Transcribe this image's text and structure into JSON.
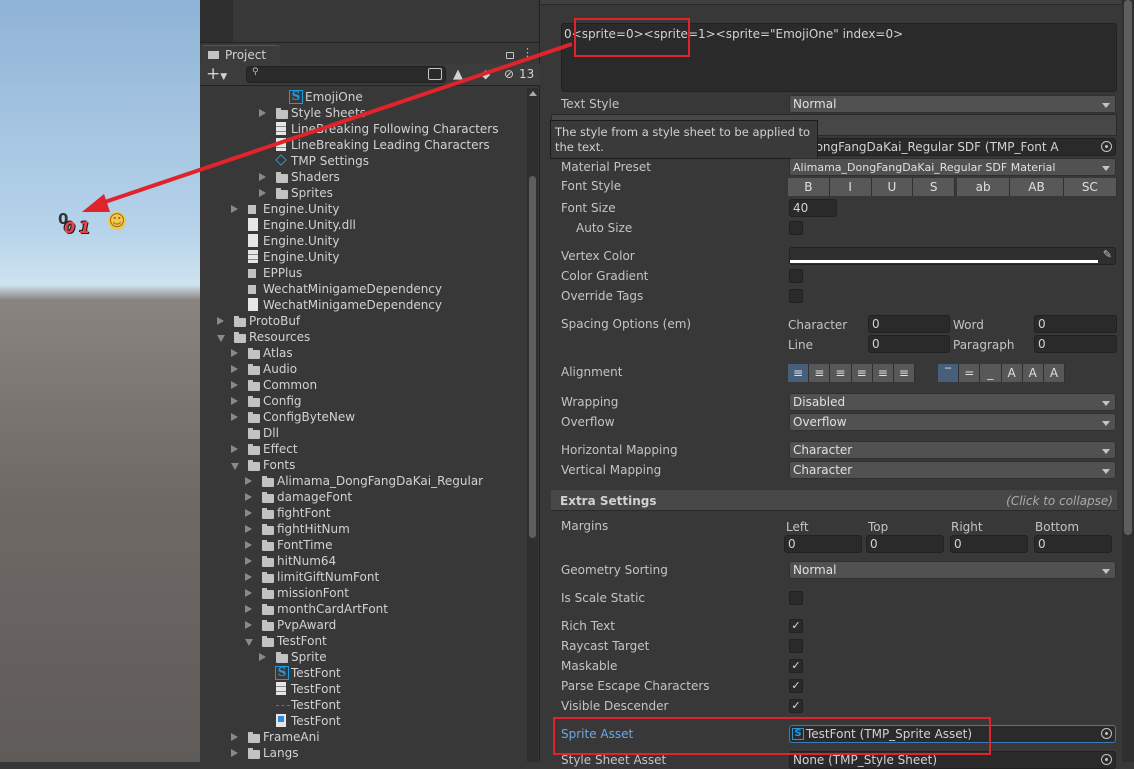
{
  "scene": {
    "rendered_text": "0",
    "sprite_digits": "01",
    "emoji": "☺"
  },
  "project": {
    "tab_label": "Project",
    "hidden_count": "13",
    "search_placeholder": "",
    "tree": [
      {
        "label": "EmojiOne",
        "level": 4,
        "icon": "sprite-asset-icon"
      },
      {
        "label": "Style Sheets",
        "level": 3,
        "icon": "folder-icon",
        "arrow": "closed"
      },
      {
        "label": "LineBreaking Following Characters",
        "level": 3,
        "icon": "text-file-icon"
      },
      {
        "label": "LineBreaking Leading Characters",
        "level": 3,
        "icon": "text-file-icon"
      },
      {
        "label": "TMP Settings",
        "level": 3,
        "icon": "settings-asset-icon"
      },
      {
        "label": "Shaders",
        "level": 3,
        "icon": "folder-icon",
        "arrow": "closed"
      },
      {
        "label": "Sprites",
        "level": 3,
        "icon": "folder-icon",
        "arrow": "closed"
      },
      {
        "label": "Engine.Unity",
        "level": 1,
        "icon": "assembly-icon",
        "arrow": "closed"
      },
      {
        "label": "Engine.Unity.dll",
        "level": 1,
        "icon": "file-icon"
      },
      {
        "label": "Engine.Unity",
        "level": 1,
        "icon": "file-icon"
      },
      {
        "label": "Engine.Unity",
        "level": 1,
        "icon": "text-file-icon"
      },
      {
        "label": "EPPlus",
        "level": 1,
        "icon": "assembly-icon"
      },
      {
        "label": "WechatMinigameDependency",
        "level": 1,
        "icon": "assembly-icon"
      },
      {
        "label": "WechatMinigameDependency",
        "level": 1,
        "icon": "file-icon"
      },
      {
        "label": "ProtoBuf",
        "level": 0,
        "icon": "folder-icon",
        "arrow": "closed"
      },
      {
        "label": "Resources",
        "level": 0,
        "icon": "folder-open-icon",
        "arrow": "open"
      },
      {
        "label": "Atlas",
        "level": 1,
        "icon": "folder-icon",
        "arrow": "closed"
      },
      {
        "label": "Audio",
        "level": 1,
        "icon": "folder-icon",
        "arrow": "closed"
      },
      {
        "label": "Common",
        "level": 1,
        "icon": "folder-icon",
        "arrow": "closed"
      },
      {
        "label": "Config",
        "level": 1,
        "icon": "folder-icon",
        "arrow": "closed"
      },
      {
        "label": "ConfigByteNew",
        "level": 1,
        "icon": "folder-icon",
        "arrow": "closed"
      },
      {
        "label": "Dll",
        "level": 1,
        "icon": "folder-icon"
      },
      {
        "label": "Effect",
        "level": 1,
        "icon": "folder-icon",
        "arrow": "closed"
      },
      {
        "label": "Fonts",
        "level": 1,
        "icon": "folder-open-icon",
        "arrow": "open"
      },
      {
        "label": "Alimama_DongFangDaKai_Regular",
        "level": 2,
        "icon": "folder-icon",
        "arrow": "closed"
      },
      {
        "label": "damageFont",
        "level": 2,
        "icon": "folder-icon",
        "arrow": "closed"
      },
      {
        "label": "fightFont",
        "level": 2,
        "icon": "folder-icon",
        "arrow": "closed"
      },
      {
        "label": "fightHitNum",
        "level": 2,
        "icon": "folder-icon",
        "arrow": "closed"
      },
      {
        "label": "FontTime",
        "level": 2,
        "icon": "folder-icon",
        "arrow": "closed"
      },
      {
        "label": "hitNum64",
        "level": 2,
        "icon": "folder-icon",
        "arrow": "closed"
      },
      {
        "label": "limitGiftNumFont",
        "level": 2,
        "icon": "folder-icon",
        "arrow": "closed"
      },
      {
        "label": "missionFont",
        "level": 2,
        "icon": "folder-icon",
        "arrow": "closed"
      },
      {
        "label": "monthCardArtFont",
        "level": 2,
        "icon": "folder-icon",
        "arrow": "closed"
      },
      {
        "label": "PvpAward",
        "level": 2,
        "icon": "folder-icon",
        "arrow": "closed"
      },
      {
        "label": "TestFont",
        "level": 2,
        "icon": "folder-open-icon",
        "arrow": "open"
      },
      {
        "label": "Sprite",
        "level": 3,
        "icon": "folder-icon",
        "arrow": "closed"
      },
      {
        "label": "TestFont",
        "level": 3,
        "icon": "sprite-asset-icon"
      },
      {
        "label": "TestFont",
        "level": 3,
        "icon": "text-file-icon"
      },
      {
        "label": "TestFont",
        "level": 3,
        "icon": "line-asset-icon"
      },
      {
        "label": "TestFont",
        "level": 3,
        "icon": "prefab-file-icon"
      },
      {
        "label": "FrameAni",
        "level": 1,
        "icon": "folder-icon",
        "arrow": "closed"
      },
      {
        "label": "Langs",
        "level": 1,
        "icon": "folder-icon",
        "arrow": "closed"
      }
    ]
  },
  "inspector": {
    "text_input": "0<sprite=0><sprite=1><sprite=\"EmojiOne\" index=0>",
    "text_style": {
      "label": "Text Style",
      "value": "Normal"
    },
    "tooltip": "The style from a style sheet to be applied to the text.",
    "font_asset": {
      "value": "a_DongFangDaKai_Regular SDF (TMP_Font A"
    },
    "material_preset": {
      "label": "Material Preset",
      "value": "Alimama_DongFangDaKai_Regular SDF Material"
    },
    "font_style": {
      "label": "Font Style",
      "buttons": [
        "B",
        "I",
        "U",
        "S",
        "ab",
        "AB",
        "SC"
      ]
    },
    "font_size": {
      "label": "Font Size",
      "value": "40"
    },
    "auto_size": {
      "label": "Auto Size",
      "checked": false
    },
    "vertex_color": {
      "label": "Vertex Color",
      "color": "#ffffff"
    },
    "color_gradient": {
      "label": "Color Gradient",
      "checked": false
    },
    "override_tags": {
      "label": "Override Tags",
      "checked": false
    },
    "spacing": {
      "label": "Spacing Options (em)",
      "character_label": "Character",
      "character": "0",
      "word_label": "Word",
      "word": "0",
      "line_label": "Line",
      "line": "0",
      "paragraph_label": "Paragraph",
      "paragraph": "0"
    },
    "alignment": {
      "label": "Alignment",
      "horizontal_selected": "left",
      "vertical_selected": "top"
    },
    "wrapping": {
      "label": "Wrapping",
      "value": "Disabled"
    },
    "overflow": {
      "label": "Overflow",
      "value": "Overflow"
    },
    "horizontal_mapping": {
      "label": "Horizontal Mapping",
      "value": "Character"
    },
    "vertical_mapping": {
      "label": "Vertical Mapping",
      "value": "Character"
    },
    "extra_settings": {
      "title": "Extra Settings",
      "hint": "(Click to collapse)"
    },
    "margins": {
      "label": "Margins",
      "left_label": "Left",
      "left": "0",
      "top_label": "Top",
      "top": "0",
      "right_label": "Right",
      "right": "0",
      "bottom_label": "Bottom",
      "bottom": "0"
    },
    "geometry_sorting": {
      "label": "Geometry Sorting",
      "value": "Normal"
    },
    "is_scale_static": {
      "label": "Is Scale Static",
      "checked": false
    },
    "rich_text": {
      "label": "Rich Text",
      "checked": true
    },
    "raycast_target": {
      "label": "Raycast Target",
      "checked": false
    },
    "maskable": {
      "label": "Maskable",
      "checked": true
    },
    "parse_escape": {
      "label": "Parse Escape Characters",
      "checked": true
    },
    "visible_descender": {
      "label": "Visible Descender",
      "checked": true
    },
    "sprite_asset": {
      "label": "Sprite Asset",
      "value": "TestFont (TMP_Sprite Asset)"
    },
    "style_sheet_asset": {
      "label": "Style Sheet Asset",
      "value": "None (TMP_Style Sheet)"
    }
  },
  "colors": {
    "annotation": "#e0242c",
    "selected_label": "#6fa8e8",
    "accent": "#46607c"
  }
}
